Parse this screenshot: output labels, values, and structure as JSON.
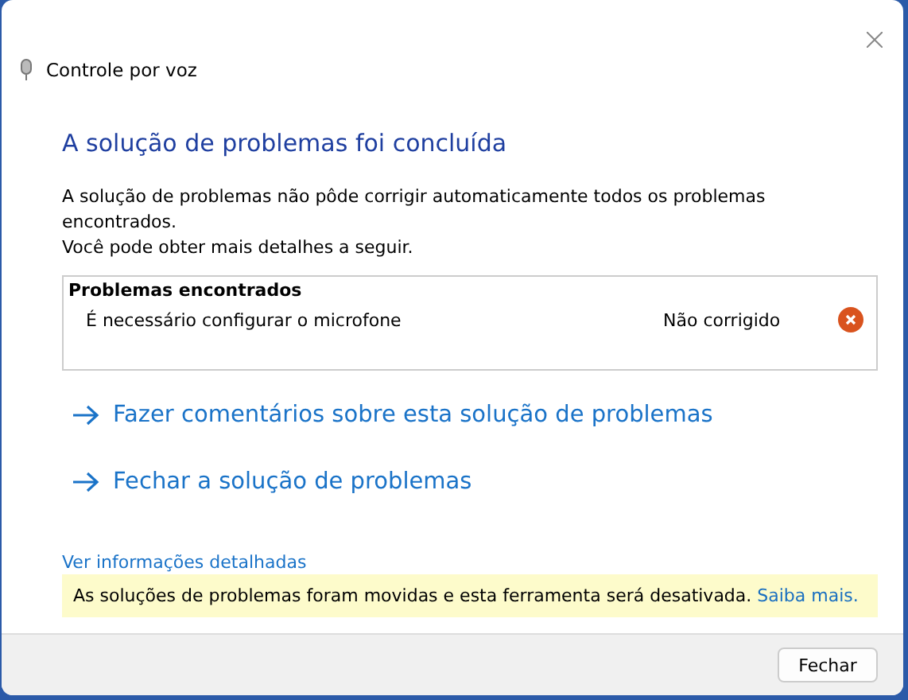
{
  "window": {
    "title": "Controle por voz"
  },
  "heading": "A solução de problemas foi concluída",
  "description": [
    "A solução de problemas não pôde corrigir automaticamente todos os problemas encontrados.",
    "Você pode obter mais detalhes a seguir."
  ],
  "problems": {
    "title": "Problemas encontrados",
    "items": [
      {
        "name": "É necessário configurar o microfone",
        "status": "Não corrigido",
        "fixed": false
      }
    ]
  },
  "actions": [
    "Fazer comentários sobre esta solução de problemas",
    "Fechar a solução de problemas"
  ],
  "details_link": "Ver informações detalhadas",
  "notice": {
    "text": "As soluções de problemas foram movidas e esta ferramenta será desativada.",
    "link": "Saiba mais."
  },
  "buttons": [
    "Fechar"
  ]
}
